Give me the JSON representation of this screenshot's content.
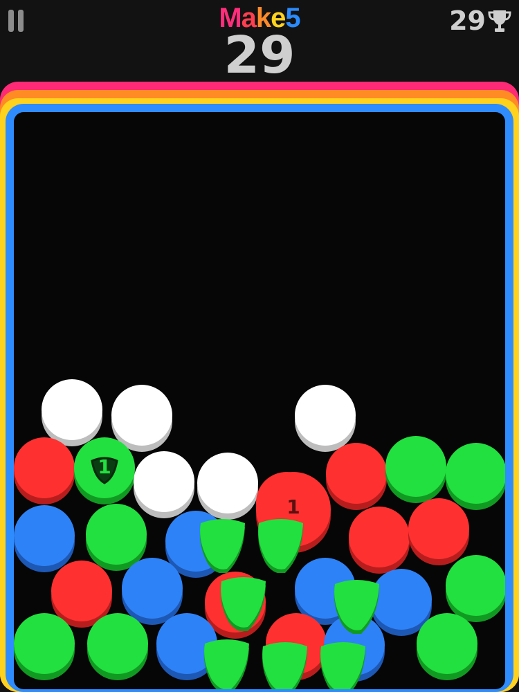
{
  "header": {
    "title_letters": [
      {
        "ch": "M",
        "color": "#ff2e7a"
      },
      {
        "ch": "a",
        "color": "#ff3e4f"
      },
      {
        "ch": "k",
        "color": "#ff8a2a"
      },
      {
        "ch": "e",
        "color": "#ffd21e"
      },
      {
        "ch": "5",
        "color": "#2a8bff"
      }
    ],
    "score": "29",
    "best_score": "29",
    "best_icon": "trophy-icon",
    "pause_icon": "pause-icon"
  },
  "frame_colors": [
    "#ff2a75",
    "#ff8b25",
    "#ffd21e",
    "#2e8cff"
  ],
  "ball_colors": {
    "red": {
      "face": "#ff3030",
      "side": "#b81d1d"
    },
    "green": {
      "face": "#22e03f",
      "side": "#119a22"
    },
    "blue": {
      "face": "#2e82f7",
      "side": "#1d58b5"
    },
    "white": {
      "face": "#ffffff",
      "side": "#bdbdbd"
    }
  },
  "balls": [
    {
      "color": "white",
      "row": 0,
      "col": 0
    },
    {
      "color": "white",
      "row": 0,
      "col": 1
    },
    {
      "color": "white",
      "row": 0,
      "col": 2
    },
    {
      "color": "red",
      "row": 1,
      "col": 0
    },
    {
      "color": "green",
      "row": 1,
      "col": 1,
      "label": "1",
      "marked": true
    },
    {
      "color": "white",
      "row": 1,
      "col": 2
    },
    {
      "color": "white",
      "row": 1,
      "col": 3
    },
    {
      "color": "red",
      "row": 1,
      "col": 4
    },
    {
      "color": "red",
      "row": 1,
      "col": 5
    },
    {
      "color": "green",
      "row": 1,
      "col": 6
    },
    {
      "color": "green",
      "row": 1,
      "col": 7
    },
    {
      "color": "blue",
      "row": 2,
      "col": 0
    },
    {
      "color": "green",
      "row": 2,
      "col": 1
    },
    {
      "color": "blue",
      "row": 2,
      "col": 2
    },
    {
      "color": "red",
      "row": 2,
      "col": 3,
      "label": "1"
    },
    {
      "color": "red",
      "row": 2,
      "col": 4
    },
    {
      "color": "red",
      "row": 2,
      "col": 5
    },
    {
      "color": "red",
      "row": 3,
      "col": 0
    },
    {
      "color": "blue",
      "row": 3,
      "col": 1
    },
    {
      "color": "red",
      "row": 3,
      "col": 2
    },
    {
      "color": "blue",
      "row": 3,
      "col": 3
    },
    {
      "color": "blue",
      "row": 3,
      "col": 4
    },
    {
      "color": "green",
      "row": 3,
      "col": 5
    },
    {
      "color": "green",
      "row": 4,
      "col": 0
    },
    {
      "color": "green",
      "row": 4,
      "col": 1
    },
    {
      "color": "blue",
      "row": 4,
      "col": 2
    },
    {
      "color": "red",
      "row": 4,
      "col": 3
    },
    {
      "color": "blue",
      "row": 4,
      "col": 4
    },
    {
      "color": "green",
      "row": 4,
      "col": 5
    }
  ],
  "pieces": [
    {
      "color": "green",
      "index": 0
    },
    {
      "color": "green",
      "index": 1
    },
    {
      "color": "green",
      "index": 2
    },
    {
      "color": "green",
      "index": 3
    },
    {
      "color": "green",
      "index": 4
    },
    {
      "color": "green",
      "index": 5
    },
    {
      "color": "green",
      "index": 6
    }
  ]
}
